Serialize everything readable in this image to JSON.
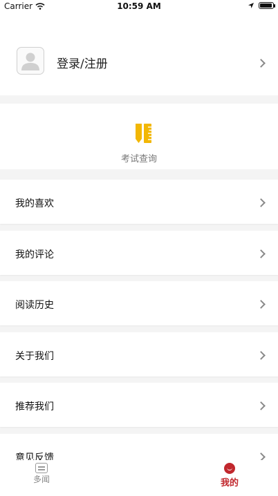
{
  "status_bar": {
    "carrier": "Carrier",
    "time": "10:59 AM",
    "icons": [
      "wifi-icon",
      "location-arrow-icon",
      "battery-icon"
    ]
  },
  "profile": {
    "login_label": "登录/注册",
    "icons": [
      "avatar-placeholder-icon",
      "chevron-right-icon"
    ]
  },
  "exam": {
    "label": "考试查询",
    "icon": "ruler-pencil-icon",
    "icon_color": "#f2b705"
  },
  "menu": {
    "items": [
      {
        "label": "我的喜欢"
      },
      {
        "label": "我的评论"
      },
      {
        "label": "阅读历史"
      },
      {
        "label": "关于我们"
      },
      {
        "label": "推荐我们"
      },
      {
        "label": "意见反馈"
      }
    ]
  },
  "tab_bar": {
    "tabs": [
      {
        "label": "多闻",
        "icon": "news-icon",
        "active": false
      },
      {
        "label": "我的",
        "icon": "smile-icon",
        "active": true
      }
    ],
    "active_color": "#c1272d"
  }
}
